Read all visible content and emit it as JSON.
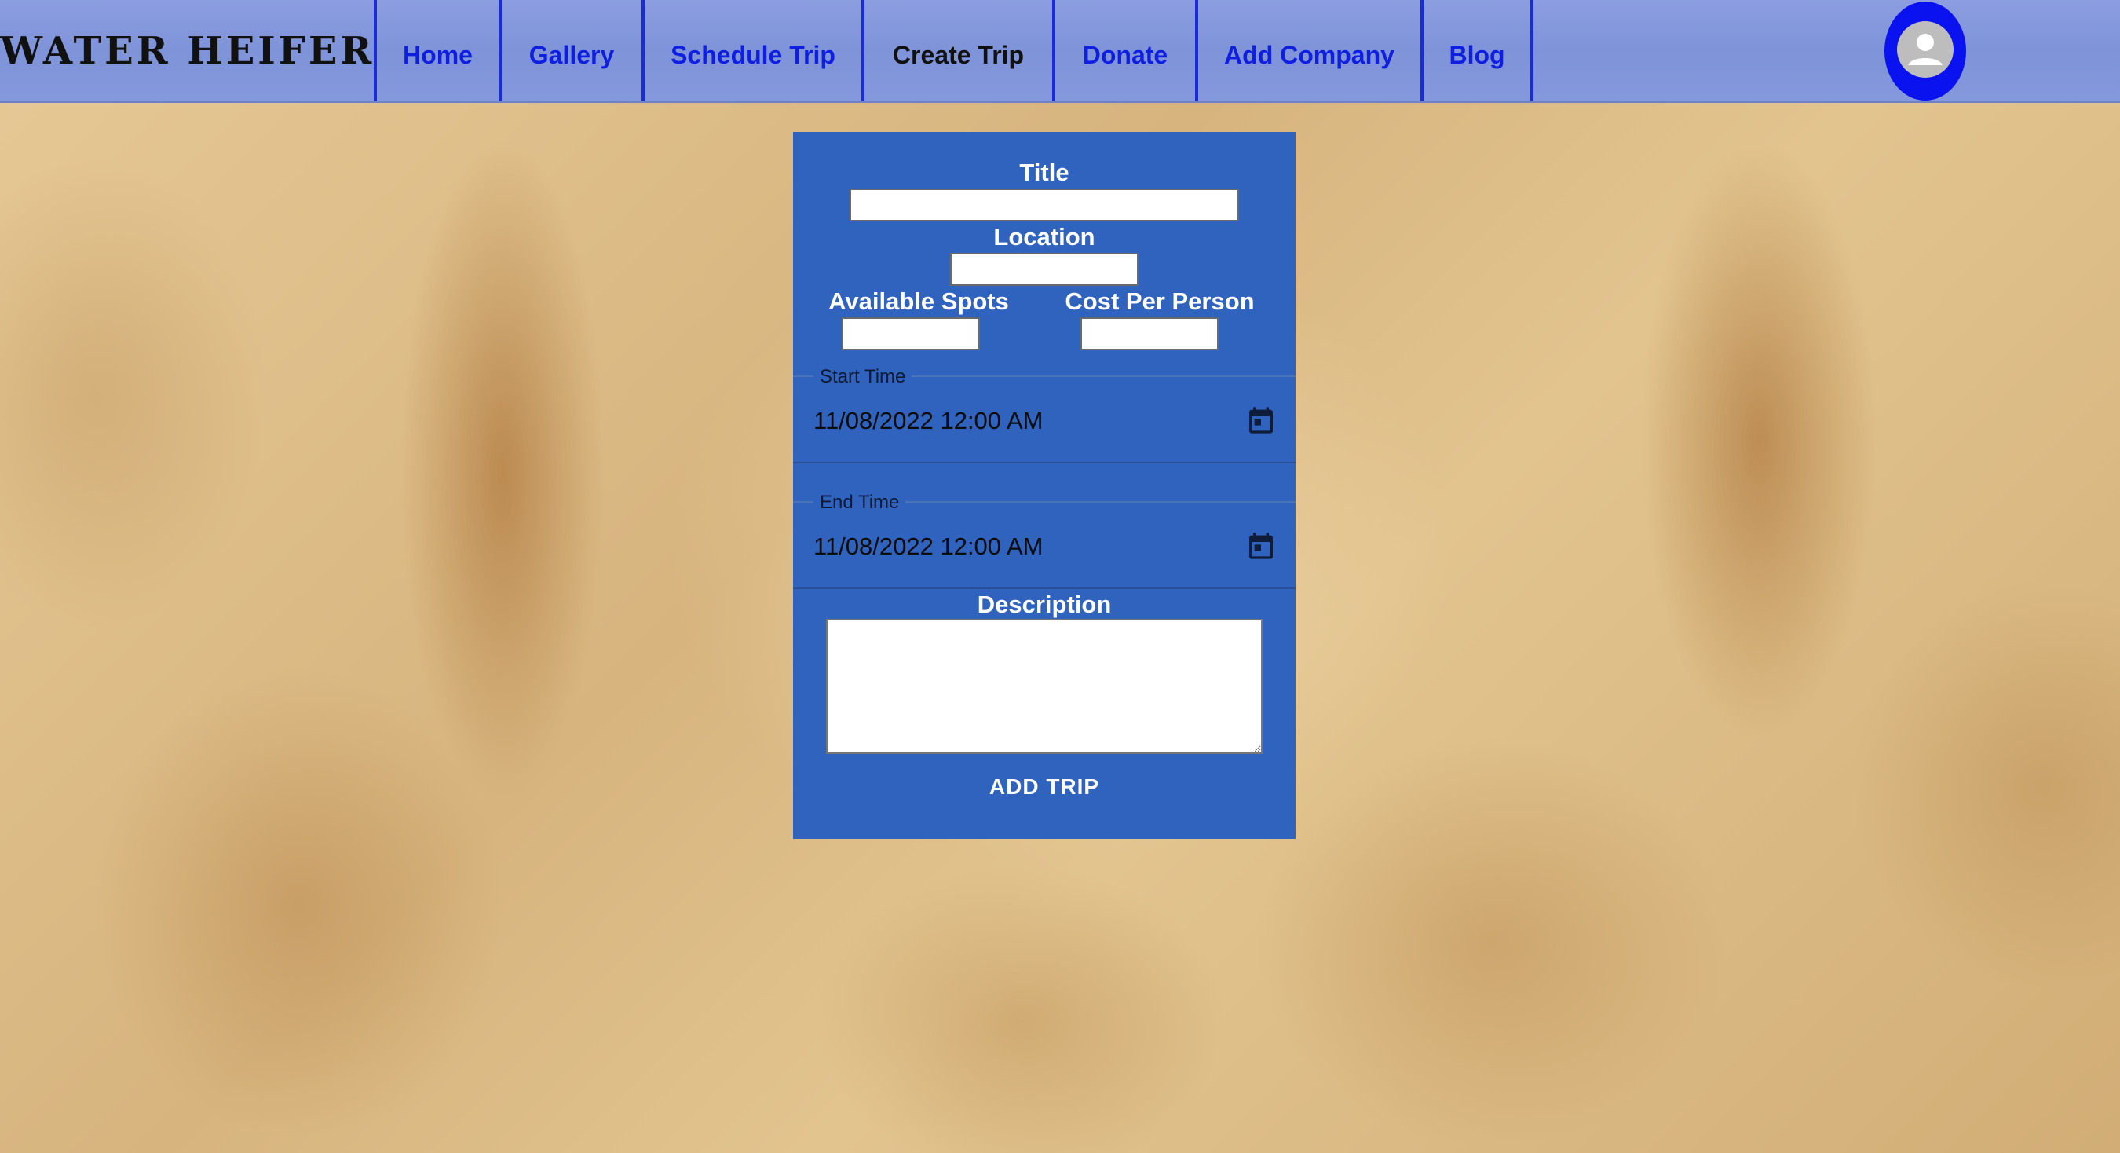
{
  "brand": "Water Heifer",
  "nav": {
    "items": [
      {
        "label": "Home"
      },
      {
        "label": "Gallery"
      },
      {
        "label": "Schedule Trip"
      },
      {
        "label": "Create Trip"
      },
      {
        "label": "Donate"
      },
      {
        "label": "Add Company"
      },
      {
        "label": "Blog"
      }
    ],
    "active": "Create Trip",
    "link_color": "#0f1fe0",
    "avatar_icon": "account-circle-icon"
  },
  "form": {
    "title_label": "Title",
    "title_value": "",
    "location_label": "Location",
    "location_value": "",
    "spots_label": "Available Spots",
    "spots_value": "",
    "cost_label": "Cost Per Person",
    "cost_value": "",
    "start_time": {
      "legend": "Start Time",
      "value": "11/08/2022 12:00 AM",
      "icon": "calendar-icon"
    },
    "end_time": {
      "legend": "End Time",
      "value": "11/08/2022 12:00 AM",
      "icon": "calendar-icon"
    },
    "description_label": "Description",
    "description_value": "",
    "submit_label": "ADD TRIP"
  },
  "colors": {
    "navbar_bg": "#8598dc",
    "card_bg": "#2f63be",
    "avatar_ring": "#0a12f0",
    "page_bg": "#d8b681"
  }
}
